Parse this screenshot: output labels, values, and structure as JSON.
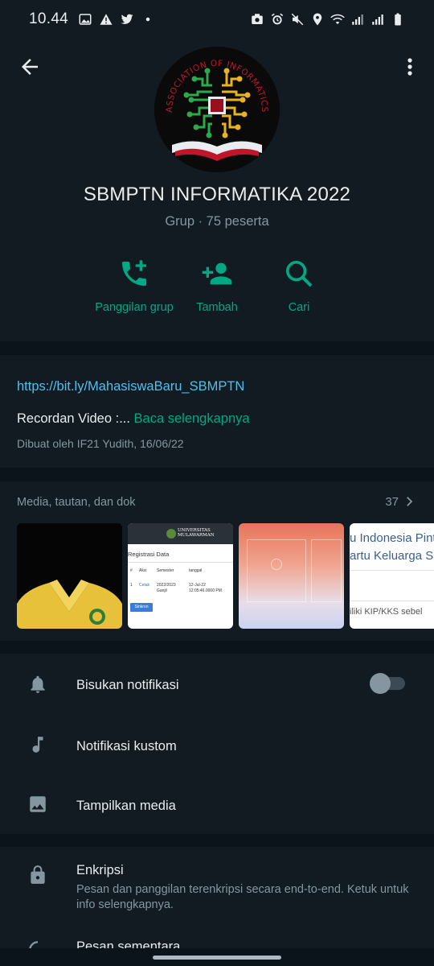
{
  "status_bar": {
    "time": "10.44",
    "left_icons": [
      "image-icon",
      "warning-icon",
      "twitter-icon",
      "dot-icon"
    ],
    "right_icons": [
      "camera-icon",
      "alarm-icon",
      "mute-icon",
      "location-icon",
      "wifi-icon",
      "signal-icon",
      "signal-icon",
      "battery-icon"
    ]
  },
  "header": {
    "group_name": "SBMPTN INFORMATIKA 2022",
    "group_info": "Grup · 75 peserta",
    "logo_text": "ASSOCIATION OF INFORMATICS",
    "actions": [
      {
        "label": "Panggilan grup",
        "icon": "call-add-icon"
      },
      {
        "label": "Tambah",
        "icon": "person-add-icon"
      },
      {
        "label": "Cari",
        "icon": "search-icon"
      }
    ]
  },
  "description": {
    "link": "https://bit.ly/MahasiswaBaru_SBMPTN",
    "text": "Recordan Video :...",
    "read_more": "Baca selengkapnya",
    "created_by": "Dibuat oleh IF21 Yudith, 16/06/22"
  },
  "media": {
    "title": "Media, tautan, dan dok",
    "count": "37",
    "thumb2": {
      "header": "UNIVERSITAS MULAWARMAN",
      "section": "Registrasi Data",
      "cols": [
        "#",
        "Aksi",
        "Semester",
        "tanggal"
      ],
      "row": [
        "1",
        "Cetak",
        "2022/2023 Ganjil",
        "12-Jul-22 12:05:46.0000 PM"
      ],
      "button": "Sinkron"
    },
    "thumb4": {
      "line1": "u Indonesia Pint",
      "line2": "artu Keluarga S",
      "line3": "iliki KIP/KKS sebel"
    }
  },
  "settings": [
    {
      "label": "Bisukan notifikasi",
      "icon": "bell-icon",
      "toggle": false
    },
    {
      "label": "Notifikasi kustom",
      "icon": "music-note-icon"
    },
    {
      "label": "Tampilkan media",
      "icon": "image-icon"
    }
  ],
  "encryption": {
    "title": "Enkripsi",
    "desc": "Pesan dan panggilan terenkripsi secara end-to-end. Ketuk untuk info selengkapnya.",
    "next_item": "Pesan sementara"
  },
  "colors": {
    "accent": "#00a884",
    "link": "#53bdeb",
    "background": "#0b141a",
    "card": "#111b21"
  }
}
